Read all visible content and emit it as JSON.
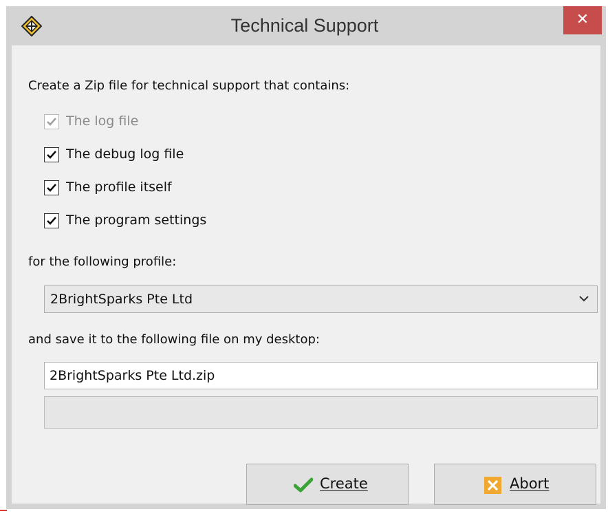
{
  "window": {
    "title": "Technical Support",
    "close_glyph": "✕",
    "icon": "app-diamond-icon"
  },
  "intro_label": "Create a Zip file for technical support that contains:",
  "options": [
    {
      "label": "The log file",
      "checked": true,
      "enabled": false
    },
    {
      "label": "The debug log file",
      "checked": true,
      "enabled": true
    },
    {
      "label": "The profile itself",
      "checked": true,
      "enabled": true
    },
    {
      "label": "The program settings",
      "checked": true,
      "enabled": true
    }
  ],
  "profile_label": "for the following profile:",
  "profile_select": {
    "value": "2BrightSparks Pte Ltd",
    "icon": "chevron-down-icon"
  },
  "file_label": "and save it to the following file on my desktop:",
  "file_input": {
    "value": "2BrightSparks Pte Ltd.zip"
  },
  "progress": {
    "value": 0
  },
  "buttons": {
    "create": {
      "label": "Create",
      "icon": "green-check-icon",
      "color": "#3aa335"
    },
    "abort": {
      "label": "Abort",
      "icon": "orange-x-icon",
      "color": "#f0a830"
    }
  },
  "colors": {
    "close_button": "#c74c4c",
    "titlebar": "#d4d4d4",
    "client": "#f0f0f0"
  }
}
